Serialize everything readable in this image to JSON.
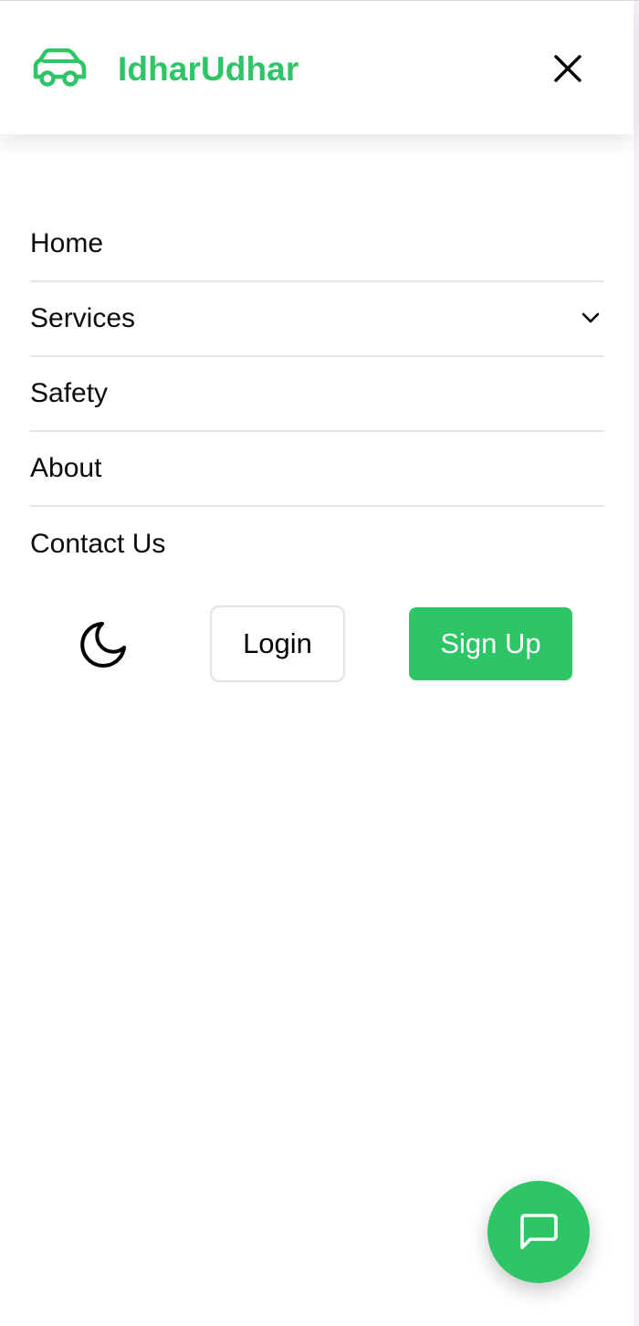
{
  "brand": {
    "name": "IdharUdhar",
    "logo_icon": "car-icon",
    "accent_color": "#2ec566"
  },
  "header": {
    "close_icon": "close-icon"
  },
  "nav": {
    "items": [
      {
        "label": "Home"
      },
      {
        "label": "Services",
        "icon": "chevron-down-icon"
      },
      {
        "label": "Safety"
      },
      {
        "label": "About"
      },
      {
        "label": "Contact Us"
      }
    ]
  },
  "actions": {
    "theme_icon": "moon-icon",
    "login_label": "Login",
    "signup_label": "Sign Up"
  },
  "chat": {
    "icon": "chat-bubble-icon"
  }
}
